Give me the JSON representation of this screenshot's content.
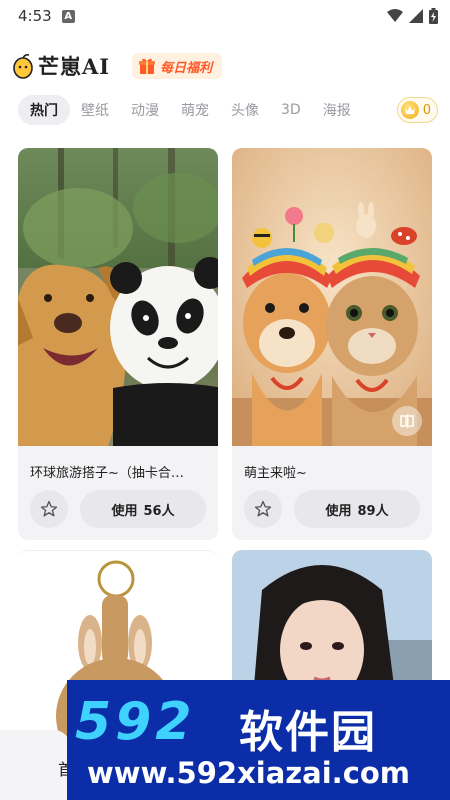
{
  "status_bar": {
    "time": "4:53",
    "notif_letter": "A"
  },
  "header": {
    "app_name": "芒崽AI",
    "welfare_label": "每日福利"
  },
  "tabs": [
    {
      "label": "热门",
      "active": true
    },
    {
      "label": "壁纸",
      "active": false
    },
    {
      "label": "动漫",
      "active": false
    },
    {
      "label": "萌宠",
      "active": false
    },
    {
      "label": "头像",
      "active": false
    },
    {
      "label": "3D",
      "active": false
    },
    {
      "label": "海报",
      "active": false
    }
  ],
  "coins": {
    "count": "0"
  },
  "cards": [
    {
      "title": "环球旅游搭子~（抽卡合…",
      "use_label": "使用",
      "use_count": "56人"
    },
    {
      "title": "萌主来啦~",
      "use_label": "使用",
      "use_count": "89人"
    },
    {
      "title": "",
      "use_label": "",
      "use_count": ""
    },
    {
      "title": "",
      "use_label": "",
      "use_count": ""
    }
  ],
  "bottom_nav": {
    "first_label": "首"
  },
  "watermark": {
    "brand": "592",
    "cn": "软件园",
    "url": "www.592xiazai.com"
  },
  "colors": {
    "accent_orange": "#ff5a2a",
    "coin_gold": "#f0b020",
    "tab_active_bg": "#eeeef2",
    "watermark_bg": "#0b2ea8"
  },
  "icons": [
    "mango-logo-icon",
    "gift-icon",
    "crown-coin-icon",
    "star-icon",
    "wifi-icon",
    "signal-icon",
    "battery-icon"
  ]
}
